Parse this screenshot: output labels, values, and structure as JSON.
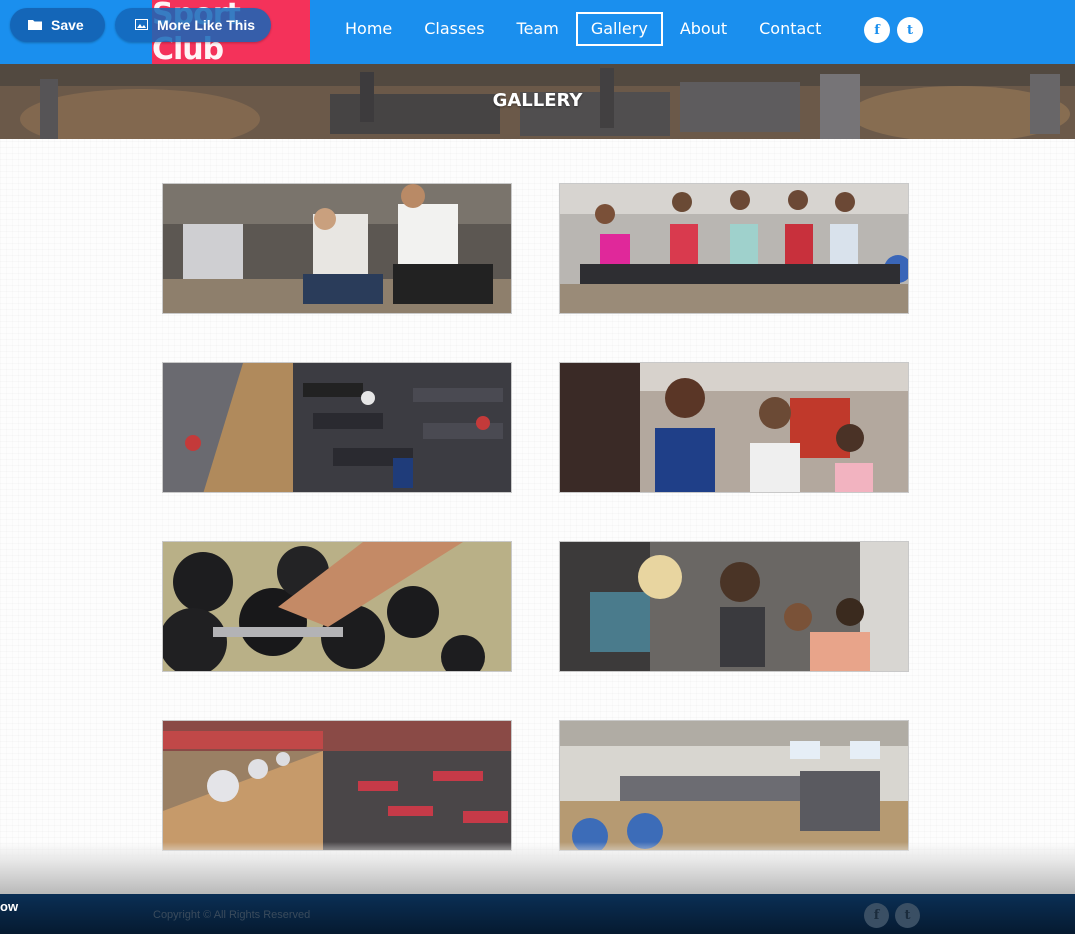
{
  "overlay": {
    "save_label": "Save",
    "save_icon": "folder-icon",
    "more_label": "More Like This",
    "more_icon": "image-icon",
    "edge_label": "ow"
  },
  "header": {
    "logo_text": "Sport Club",
    "nav": [
      {
        "label": "Home",
        "active": false
      },
      {
        "label": "Classes",
        "active": false
      },
      {
        "label": "Team",
        "active": false
      },
      {
        "label": "Gallery",
        "active": true
      },
      {
        "label": "About",
        "active": false
      },
      {
        "label": "Contact",
        "active": false
      }
    ],
    "social": [
      {
        "glyph": "f",
        "icon": "facebook-icon"
      },
      {
        "glyph": "t",
        "icon": "twitter-icon"
      }
    ]
  },
  "banner": {
    "title": "GALLERY"
  },
  "gallery": {
    "items": [
      {
        "subject": "gym-rowing-couple-photo"
      },
      {
        "subject": "spin-class-photo"
      },
      {
        "subject": "treadmill-hall-photo"
      },
      {
        "subject": "women-workout-photo"
      },
      {
        "subject": "dumbbell-rack-photo"
      },
      {
        "subject": "group-class-photo"
      },
      {
        "subject": "weight-machines-photo"
      },
      {
        "subject": "gym-floor-photo"
      }
    ]
  },
  "footer": {
    "copyright": "Copyright © All Rights Reserved",
    "social": [
      {
        "glyph": "f",
        "icon": "facebook-icon"
      },
      {
        "glyph": "t",
        "icon": "twitter-icon"
      }
    ]
  },
  "colors": {
    "header_blue": "#1a8fee",
    "logo_red": "#f4325a",
    "footer_navy": "#061a30"
  }
}
